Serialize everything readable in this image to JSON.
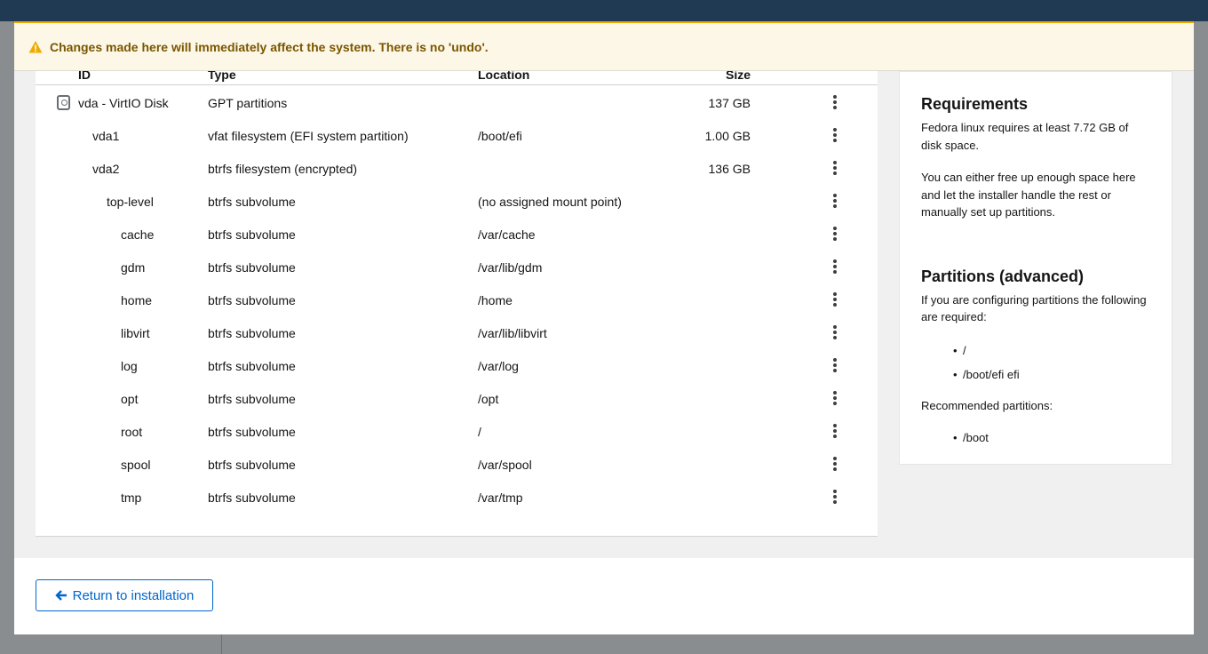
{
  "alert": {
    "title": "Changes made here will immediately affect the system. There is no 'undo'."
  },
  "table": {
    "headers": {
      "id": "ID",
      "type": "Type",
      "location": "Location",
      "size": "Size"
    },
    "rows": [
      {
        "id": "vda - VirtIO Disk",
        "type": "GPT partitions",
        "location": "",
        "size": "137 GB",
        "icon": "disk-icon"
      },
      {
        "id": "vda1",
        "type": "vfat filesystem (EFI system partition)",
        "location": "/boot/efi",
        "size": "1.00 GB"
      },
      {
        "id": "vda2",
        "type": "btrfs filesystem (encrypted)",
        "location": "",
        "size": "136 GB"
      },
      {
        "id": "top-level",
        "type": "btrfs subvolume",
        "location": "(no assigned mount point)",
        "size": ""
      },
      {
        "id": "cache",
        "type": "btrfs subvolume",
        "location": "/var/cache",
        "size": ""
      },
      {
        "id": "gdm",
        "type": "btrfs subvolume",
        "location": "/var/lib/gdm",
        "size": ""
      },
      {
        "id": "home",
        "type": "btrfs subvolume",
        "location": "/home",
        "size": ""
      },
      {
        "id": "libvirt",
        "type": "btrfs subvolume",
        "location": "/var/lib/libvirt",
        "size": ""
      },
      {
        "id": "log",
        "type": "btrfs subvolume",
        "location": "/var/log",
        "size": ""
      },
      {
        "id": "opt",
        "type": "btrfs subvolume",
        "location": "/opt",
        "size": ""
      },
      {
        "id": "root",
        "type": "btrfs subvolume",
        "location": "/",
        "size": ""
      },
      {
        "id": "spool",
        "type": "btrfs subvolume",
        "location": "/var/spool",
        "size": ""
      },
      {
        "id": "tmp",
        "type": "btrfs subvolume",
        "location": "/var/tmp",
        "size": ""
      }
    ]
  },
  "sidebar": {
    "requirements_title": "Requirements",
    "requirements_text1": "Fedora linux requires at least 7.72 GB of disk space.",
    "requirements_text2": "You can either free up enough space here and let the installer handle the rest or manually set up partitions.",
    "partitions_title": "Partitions (advanced)",
    "partitions_text": "If you are configuring partitions the following are required:",
    "required": [
      "/",
      "/boot/efi efi"
    ],
    "recommended_label": "Recommended partitions:",
    "recommended": [
      "/boot"
    ]
  },
  "footer": {
    "return_label": "Return to installation"
  },
  "colors": {
    "link": "#0066cc",
    "warning_bg": "#fdf7e7",
    "warning_text": "#795600",
    "warning_icon": "#f0ab00"
  }
}
